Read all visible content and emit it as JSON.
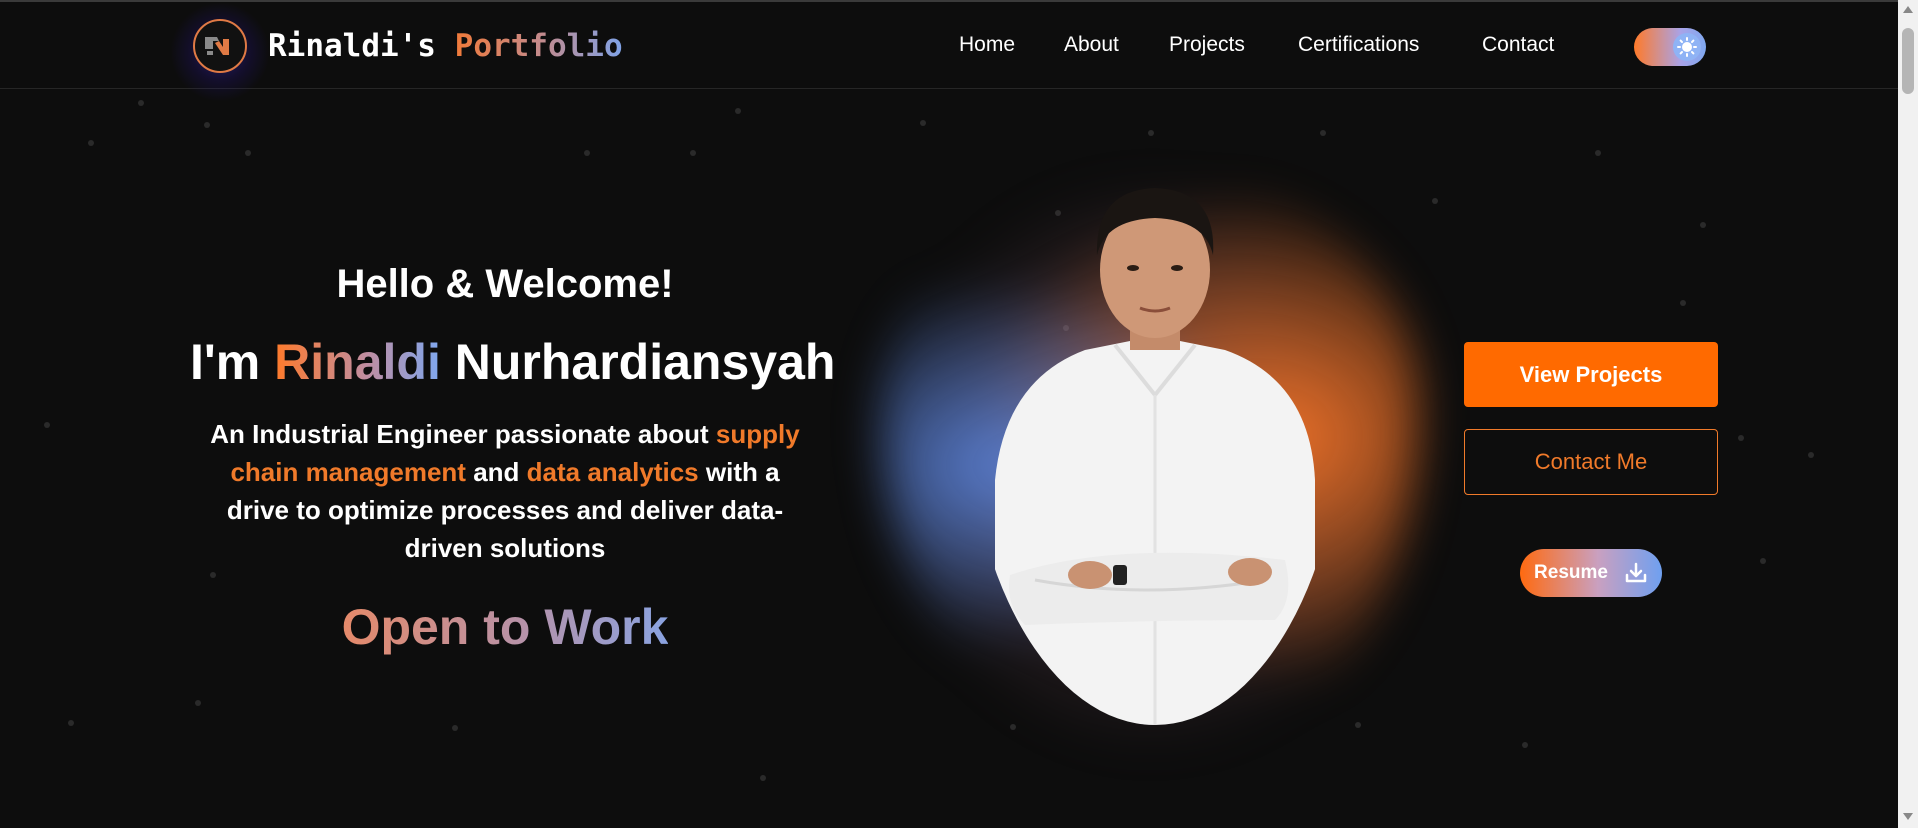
{
  "header": {
    "brand_name": "Rinaldi's",
    "brand_suffix": "Portfolio",
    "logo_icon": "rn-monogram-icon",
    "nav": [
      {
        "label": "Home"
      },
      {
        "label": "About"
      },
      {
        "label": "Projects"
      },
      {
        "label": "Certifications"
      },
      {
        "label": "Contact"
      }
    ],
    "theme_toggle_icon": "sun-icon"
  },
  "hero": {
    "greeting": "Hello & Welcome!",
    "name_prefix": "I'm",
    "first_name": "Rinaldi",
    "last_name": "Nurhardiansyah",
    "description": {
      "part1": "An Industrial Engineer passionate about",
      "highlight1": "supply chain management",
      "part2": "and",
      "highlight2": "data analytics",
      "part3": "with a drive to optimize processes and deliver data-driven solutions"
    },
    "status": "Open to Work",
    "portrait_icon": "profile-photo"
  },
  "actions": {
    "view_projects": "View Projects",
    "contact_me": "Contact Me",
    "resume": "Resume",
    "resume_icon": "download-icon"
  },
  "colors": {
    "accent": "#ff6a00",
    "accent_blue": "#7fa8f0",
    "background": "#0d0d0d"
  }
}
